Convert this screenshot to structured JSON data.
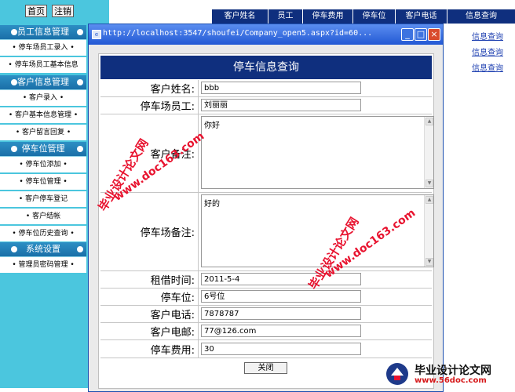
{
  "sidebar": {
    "top_buttons": [
      "首页",
      "注销"
    ],
    "sections": [
      {
        "title": "员工信息管理",
        "items": [
          "• 停车场员工录入 •",
          "• 停车场员工基本信息"
        ]
      },
      {
        "title": "客户信息管理",
        "items": [
          "• 客户录入 •",
          "• 客户基本信息管理 •",
          "• 客户留言回复 •"
        ]
      },
      {
        "title": "停车位管理",
        "items": [
          "• 停车位添加 •",
          "• 停车位管理 •",
          "• 客户停车登记",
          "• 客户结帐",
          "• 停车位历史查询 •"
        ]
      },
      {
        "title": "系统设置",
        "items": [
          "• 管理员密码管理 •"
        ]
      }
    ]
  },
  "right_table": {
    "headers": [
      "客户姓名",
      "员工",
      "停车费用",
      "停车位",
      "客户电话",
      "信息查询"
    ],
    "links": [
      "信息查询",
      "信息查询",
      "信息查询"
    ]
  },
  "popup": {
    "title": "http://localhost:3547/shoufei/Company_open5.aspx?id=60...",
    "form_title": "停车信息查询",
    "fields": {
      "customer_name": {
        "label": "客户姓名:",
        "value": "bbb"
      },
      "staff": {
        "label": "停车场员工:",
        "value": "刘丽丽"
      },
      "customer_note": {
        "label": "客户备注:",
        "value": "你好"
      },
      "lot_note": {
        "label": "停车场备注:",
        "value": "好的"
      },
      "rent_time": {
        "label": "租借时间:",
        "value": "2011-5-4"
      },
      "slot": {
        "label": "停车位:",
        "value": "6号位"
      },
      "phone": {
        "label": "客户电话:",
        "value": "7878787"
      },
      "email": {
        "label": "客户电邮:",
        "value": "77@126.com"
      },
      "fee": {
        "label": "停车费用:",
        "value": "30"
      }
    },
    "close_label": "关闭"
  },
  "watermarks": {
    "site_text": "毕业设计论文网",
    "url_text": "www.doc163.com",
    "logo_text": "毕业设计论文网",
    "logo_url": "www.56doc.com"
  }
}
